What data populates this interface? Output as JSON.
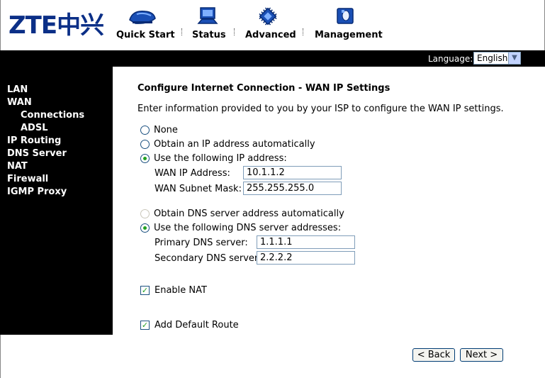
{
  "brand": {
    "logo_text": "ZTE中兴"
  },
  "nav": [
    {
      "label": "Quick Start",
      "icon": "quick-start-icon"
    },
    {
      "label": "Status",
      "icon": "status-icon"
    },
    {
      "label": "Advanced",
      "icon": "advanced-icon"
    },
    {
      "label": "Management",
      "icon": "management-icon"
    }
  ],
  "language": {
    "label": "Language:",
    "selected": "English"
  },
  "sidebar": {
    "items": [
      {
        "label": "LAN"
      },
      {
        "label": "WAN"
      },
      {
        "label": "Connections"
      },
      {
        "label": "ADSL"
      },
      {
        "label": "IP Routing"
      },
      {
        "label": "DNS Server"
      },
      {
        "label": "NAT"
      },
      {
        "label": "Firewall"
      },
      {
        "label": "IGMP Proxy"
      }
    ]
  },
  "main": {
    "title": "Configure Internet Connection - WAN IP Settings",
    "description": "Enter information provided to you by your ISP to configure the WAN IP settings.",
    "ip_options": [
      {
        "label": "None",
        "checked": false
      },
      {
        "label": "Obtain an IP address automatically",
        "checked": false
      },
      {
        "label": "Use the following IP address:",
        "checked": true
      }
    ],
    "wan_ip": {
      "label": "WAN IP Address:",
      "value": "10.1.1.2"
    },
    "wan_mask": {
      "label": "WAN Subnet Mask:",
      "value": "255.255.255.0"
    },
    "dns_options": [
      {
        "label": "Obtain DNS server address automatically",
        "checked": false,
        "disabled": true
      },
      {
        "label": "Use the following DNS server addresses:",
        "checked": true
      }
    ],
    "primary_dns": {
      "label": "Primary DNS server:",
      "value": "1.1.1.1"
    },
    "secondary_dns": {
      "label": "Secondary DNS server:",
      "value": "2.2.2.2"
    },
    "enable_nat": {
      "label": "Enable NAT",
      "checked": true
    },
    "default_route": {
      "label": "Add Default Route",
      "checked": true
    },
    "back_button": "< Back",
    "next_button": "Next >"
  },
  "colors": {
    "logo": "#0b2f87",
    "frame": "#000000",
    "radio_dot": "#21a121"
  }
}
